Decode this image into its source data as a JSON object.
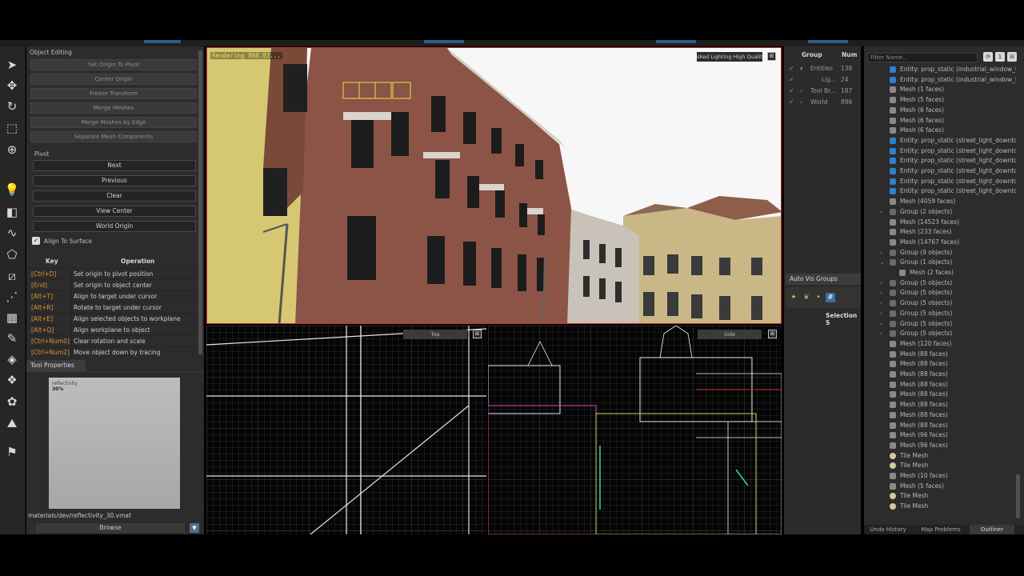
{
  "colors": {
    "accent": "#2a5f8a",
    "viewport_border": "#c8322d",
    "key_color": "#e0922e",
    "check_color": "#5ec25e"
  },
  "toolbar_icons": [
    "select-arrow-icon",
    "move-icon",
    "rotate-icon",
    "scale-icon",
    "pivot-icon",
    "light-icon",
    "block-icon",
    "path-icon",
    "polygon-icon",
    "clip-icon",
    "vertex-icon",
    "material-icon",
    "paint-icon",
    "tile-icon",
    "instance-icon",
    "plant-icon",
    "terrain-icon",
    "entity-icon"
  ],
  "object_editing": {
    "title": "Object Editing",
    "buttons": [
      "Set Origin To Pivot",
      "Center Origin",
      "Freeze Transform",
      "Merge Meshes",
      "Merge Meshes by Edge",
      "Separate Mesh Components"
    ]
  },
  "pivot": {
    "title": "Pivot",
    "buttons": [
      "Next",
      "Previous",
      "Clear",
      "View Center",
      "World Origin"
    ],
    "align_to_surface": "Align To Surface"
  },
  "key_table": {
    "headers": {
      "key": "Key",
      "operation": "Operation"
    },
    "rows": [
      {
        "key": "[Ctrl+D]",
        "operation": "Set origin to pivot position"
      },
      {
        "key": "[End]",
        "operation": "Set origin to object center"
      },
      {
        "key": "[Alt+T]",
        "operation": "Align to target under cursor"
      },
      {
        "key": "[Alt+R]",
        "operation": "Rotate to target under cursor"
      },
      {
        "key": "[Alt+E]",
        "operation": "Align selected objects to workplane"
      },
      {
        "key": "[Alt+Q]",
        "operation": "Align workplane to object"
      },
      {
        "key": "[Ctrl+Num0]",
        "operation": "Clear rotation and scale"
      },
      {
        "key": "[Ctrl+Num2]",
        "operation": "Move object down by tracing"
      }
    ]
  },
  "tool_properties": {
    "tab": "Tool Properties",
    "thumb_caption": "reflectivity",
    "thumb_pct": "30%",
    "material_path": "materials/dev/reflectivity_30.vmat",
    "browse": "Browse"
  },
  "viewport_3d": {
    "status": "Rendering 860.03...",
    "mode": "sked Lighting High Qualit"
  },
  "viewport_top": {
    "label": "Top"
  },
  "viewport_side": {
    "label": "Side"
  },
  "groups": {
    "headers": {
      "group": "Group",
      "num": "Num"
    },
    "rows": [
      {
        "name": "Entities",
        "num": "138",
        "expand": "▾"
      },
      {
        "name": "Lig...",
        "num": "24",
        "expand": ""
      },
      {
        "name": "Tool Br...",
        "num": "187",
        "expand": "›"
      },
      {
        "name": "World",
        "num": "896",
        "expand": "›"
      }
    ],
    "auto_vis_tab": "Auto Vis Groups",
    "selection_label": "Selection S"
  },
  "outliner": {
    "filter_placeholder": "Filter Name...",
    "items": [
      {
        "type": "entity",
        "indent": 0,
        "label": "Entity: prop_static (industrial_window_t..."
      },
      {
        "type": "entity",
        "indent": 0,
        "label": "Entity: prop_static (industrial_window_t..."
      },
      {
        "type": "mesh",
        "indent": 0,
        "label": "Mesh (1 faces)"
      },
      {
        "type": "mesh",
        "indent": 0,
        "label": "Mesh (5 faces)"
      },
      {
        "type": "mesh",
        "indent": 0,
        "label": "Mesh (6 faces)"
      },
      {
        "type": "mesh",
        "indent": 0,
        "label": "Mesh (6 faces)"
      },
      {
        "type": "mesh",
        "indent": 0,
        "label": "Mesh (6 faces)"
      },
      {
        "type": "entity",
        "indent": 0,
        "label": "Entity: prop_static (street_light_downto..."
      },
      {
        "type": "entity",
        "indent": 0,
        "label": "Entity: prop_static (street_light_downto..."
      },
      {
        "type": "entity",
        "indent": 0,
        "label": "Entity: prop_static (street_light_downto..."
      },
      {
        "type": "entity",
        "indent": 0,
        "label": "Entity: prop_static (street_light_downto..."
      },
      {
        "type": "entity",
        "indent": 0,
        "label": "Entity: prop_static (street_light_downto..."
      },
      {
        "type": "entity",
        "indent": 0,
        "label": "Entity: prop_static (street_light_downto..."
      },
      {
        "type": "mesh",
        "indent": 0,
        "label": "Mesh (4059 faces)"
      },
      {
        "type": "group",
        "indent": 0,
        "arrow": "›",
        "label": "Group (2 objects)"
      },
      {
        "type": "mesh",
        "indent": 0,
        "label": "Mesh (14523 faces)"
      },
      {
        "type": "mesh",
        "indent": 0,
        "label": "Mesh (233 faces)"
      },
      {
        "type": "mesh",
        "indent": 0,
        "label": "Mesh (14767 faces)"
      },
      {
        "type": "group",
        "indent": 0,
        "arrow": "›",
        "label": "Group (9 objects)"
      },
      {
        "type": "group",
        "indent": 0,
        "arrow": "⌄",
        "label": "Group (1 objects)"
      },
      {
        "type": "mesh",
        "indent": 1,
        "label": "Mesh (2 faces)"
      },
      {
        "type": "group",
        "indent": 0,
        "arrow": "›",
        "label": "Group (5 objects)"
      },
      {
        "type": "group",
        "indent": 0,
        "arrow": "›",
        "label": "Group (5 objects)"
      },
      {
        "type": "group",
        "indent": 0,
        "arrow": "›",
        "label": "Group (5 objects)"
      },
      {
        "type": "group",
        "indent": 0,
        "arrow": "›",
        "label": "Group (5 objects)"
      },
      {
        "type": "group",
        "indent": 0,
        "arrow": "›",
        "label": "Group (5 objects)"
      },
      {
        "type": "group",
        "indent": 0,
        "arrow": "›",
        "label": "Group (5 objects)"
      },
      {
        "type": "mesh",
        "indent": 0,
        "label": "Mesh (120 faces)"
      },
      {
        "type": "mesh",
        "indent": 0,
        "label": "Mesh (88 faces)"
      },
      {
        "type": "mesh",
        "indent": 0,
        "label": "Mesh (88 faces)"
      },
      {
        "type": "mesh",
        "indent": 0,
        "label": "Mesh (88 faces)"
      },
      {
        "type": "mesh",
        "indent": 0,
        "label": "Mesh (88 faces)"
      },
      {
        "type": "mesh",
        "indent": 0,
        "label": "Mesh (88 faces)"
      },
      {
        "type": "mesh",
        "indent": 0,
        "label": "Mesh (88 faces)"
      },
      {
        "type": "mesh",
        "indent": 0,
        "label": "Mesh (88 faces)"
      },
      {
        "type": "mesh",
        "indent": 0,
        "label": "Mesh (88 faces)"
      },
      {
        "type": "mesh",
        "indent": 0,
        "label": "Mesh (96 faces)"
      },
      {
        "type": "mesh",
        "indent": 0,
        "label": "Mesh (96 faces)"
      },
      {
        "type": "tile",
        "indent": 0,
        "label": "Tile Mesh"
      },
      {
        "type": "tile",
        "indent": 0,
        "label": "Tile Mesh"
      },
      {
        "type": "mesh",
        "indent": 0,
        "label": "Mesh (10 faces)"
      },
      {
        "type": "mesh",
        "indent": 0,
        "label": "Mesh (5 faces)"
      },
      {
        "type": "tile",
        "indent": 0,
        "label": "Tile Mesh"
      },
      {
        "type": "tile",
        "indent": 0,
        "label": "Tile Mesh"
      }
    ],
    "tabs": [
      "Undo History",
      "Map Problems",
      "Outliner"
    ]
  }
}
